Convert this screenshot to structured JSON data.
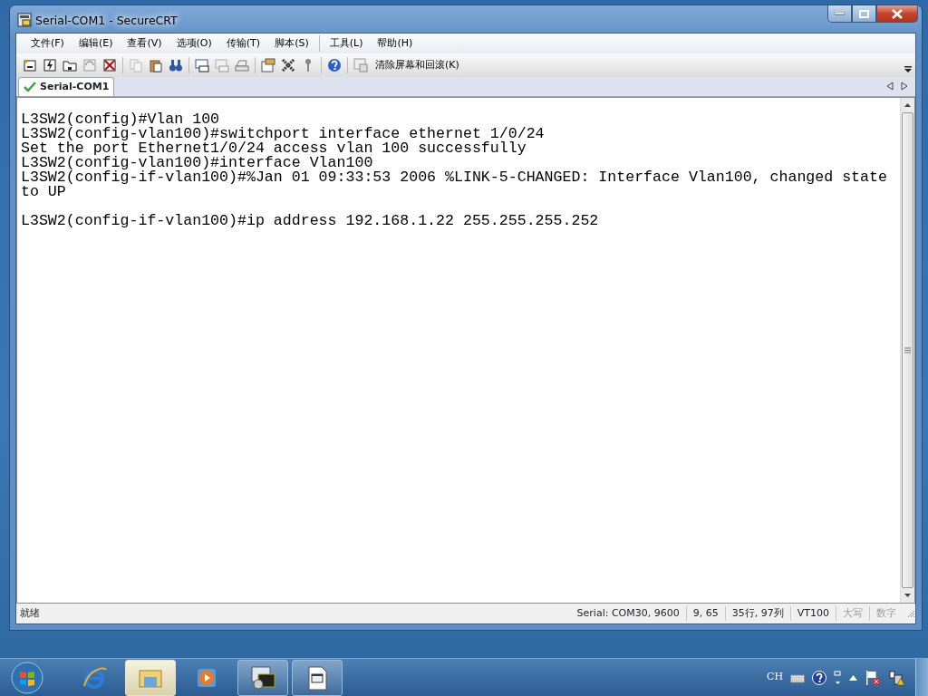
{
  "window": {
    "title": "Serial-COM1 - SecureCRT"
  },
  "menu": [
    "文件(F)",
    "编辑(E)",
    "查看(V)",
    "选项(O)",
    "传输(T)",
    "脚本(S)",
    "工具(L)",
    "帮助(H)"
  ],
  "toolbar": {
    "clear_button": {
      "label": "清除屏幕和回滚(K)"
    }
  },
  "tabs": [
    {
      "label": "Serial-COM1",
      "selected": true
    }
  ],
  "terminal": {
    "blocks": [
      [
        "L3SW2(config)#Vlan 100",
        "L3SW2(config-vlan100)#switchport interface ethernet 1/0/24",
        "Set the port Ethernet1/0/24 access vlan 100 successfully",
        "L3SW2(config-vlan100)#interface Vlan100",
        "L3SW2(config-if-vlan100)#%Jan 01 09:33:53 2006 %LINK-5-CHANGED: Interface Vlan100, changed state",
        "to UP"
      ],
      [
        "L3SW2(config-if-vlan100)#ip address 192.168.1.22 255.255.255.252"
      ]
    ]
  },
  "status_bar": {
    "message": "就绪",
    "fields": [
      {
        "text": "Serial: COM30, 9600",
        "disabled": false
      },
      {
        "text": "9,  65",
        "disabled": false
      },
      {
        "text": "35行, 97列",
        "disabled": false
      },
      {
        "text": "VT100",
        "disabled": false
      },
      {
        "text": "大写",
        "disabled": true
      },
      {
        "text": "数字",
        "disabled": true
      }
    ]
  },
  "taskbar": {
    "items": [
      {
        "running": false,
        "selected": false
      },
      {
        "running": true,
        "selected": true
      },
      {
        "running": false,
        "selected": false
      },
      {
        "running": true,
        "selected": false
      },
      {
        "running": true,
        "selected": false
      }
    ],
    "tray": {
      "language": "CH"
    }
  }
}
